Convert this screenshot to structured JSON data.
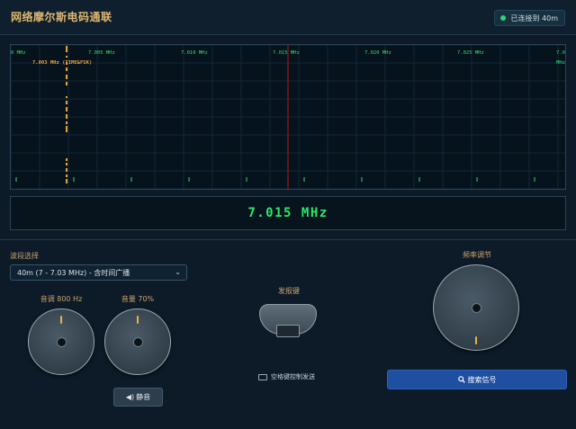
{
  "header": {
    "title": "网络摩尔斯电码通联",
    "connection_status": "已连接到 40m",
    "status_color": "#2ed573"
  },
  "waterfall": {
    "freq_labels": [
      "0 MHz",
      "7.005 MHz",
      "7.010 MHz",
      "7.015 MHz",
      "7.020 MHz",
      "7.025 MHz",
      "7.0"
    ],
    "right_edge_fragment": "MHz",
    "marker_label": "7.003 MHz (TIME&FSK)",
    "marker_color": "#e8a23c",
    "center_line_color": "#8a1c1c",
    "label_color": "#2ee06a"
  },
  "frequency_display": {
    "value": "7.015 MHz"
  },
  "band": {
    "label": "波段选择",
    "selected": "40m (7 - 7.03 MHz) - 含时间广播"
  },
  "tone": {
    "label": "音调 800 Hz"
  },
  "volume": {
    "label": "音量 70%"
  },
  "mute_button": {
    "label": "静音",
    "icon": "speaker-icon"
  },
  "key": {
    "label": "发报键",
    "hint": "空格键控制发送",
    "hint_icon": "keyboard-icon"
  },
  "tuning": {
    "label": "频率调节"
  },
  "search_button": {
    "label": "搜索信号",
    "icon": "search-icon"
  }
}
